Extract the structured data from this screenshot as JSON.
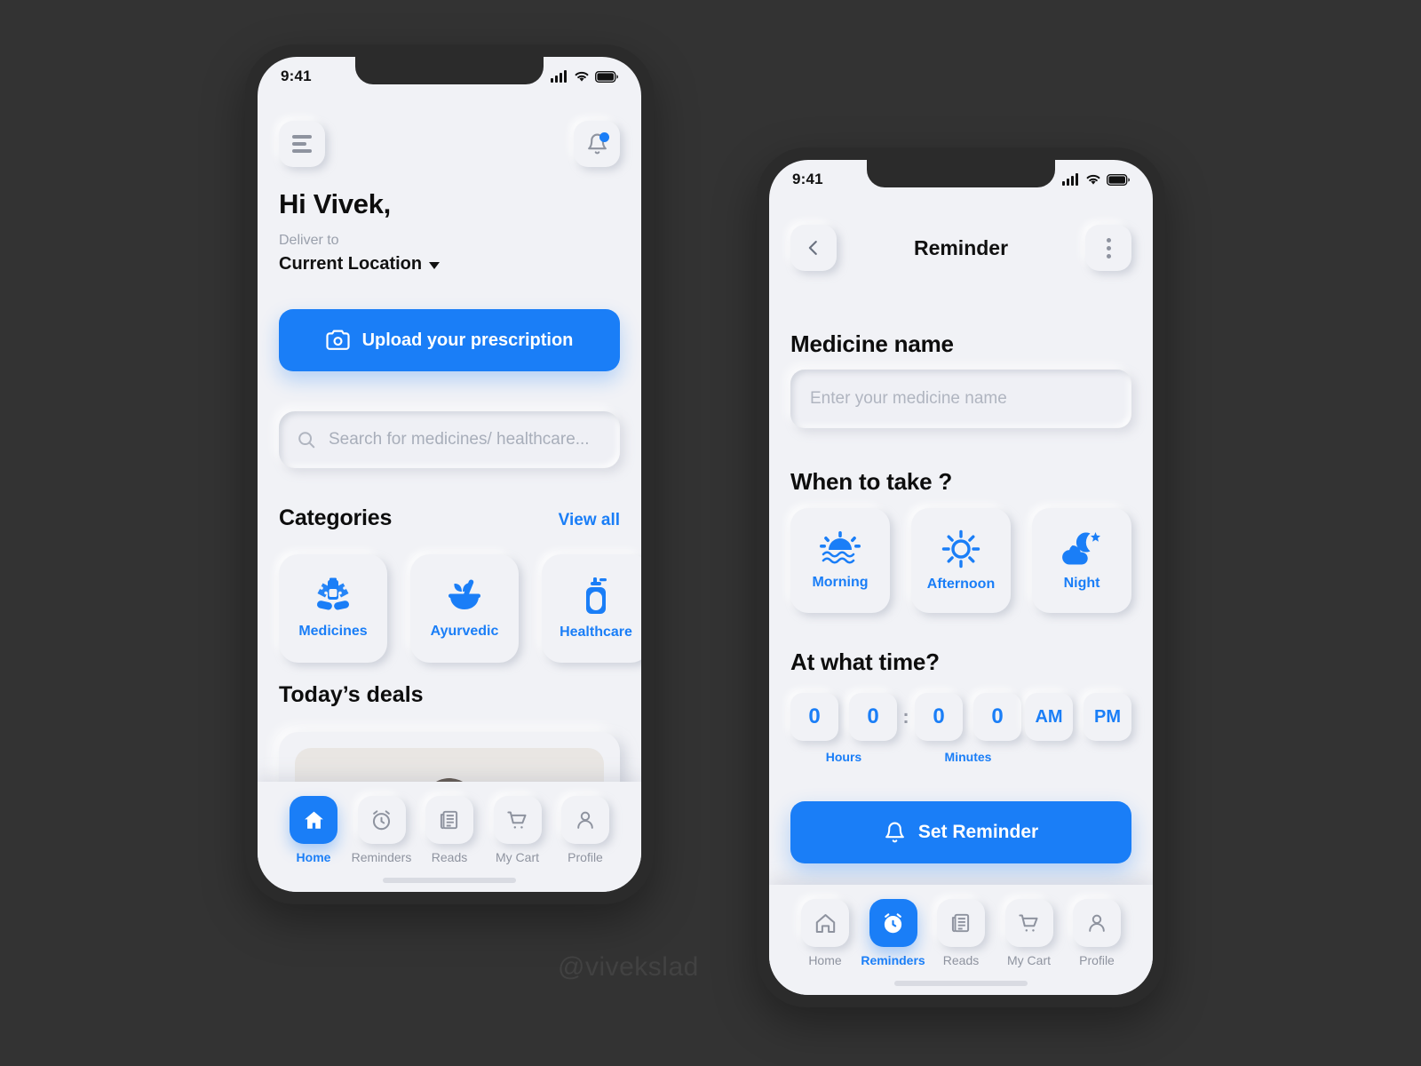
{
  "watermark": "@vivekslad",
  "colors": {
    "accent": "#1a7ef7",
    "screen_bg": "#f1f2f6",
    "page_bg": "#333333",
    "muted": "#8e939f"
  },
  "phone1": {
    "status": {
      "time": "9:41",
      "icons": [
        "signal-icon",
        "wifi-icon",
        "battery-icon"
      ]
    },
    "menu_icon": "hamburger-menu-icon",
    "bell_icon": "notification-bell-icon",
    "greeting": "Hi Vivek,",
    "deliver_label": "Deliver to",
    "deliver_value": "Current Location",
    "upload": {
      "label": "Upload your prescription",
      "icon": "camera-icon"
    },
    "search": {
      "placeholder": "Search for medicines/ healthcare...",
      "icon": "search-icon"
    },
    "categories": {
      "title": "Categories",
      "view_all": "View all",
      "items": [
        {
          "label": "Medicines",
          "icon": "pills-blister-icon"
        },
        {
          "label": "Ayurvedic",
          "icon": "mortar-pestle-icon"
        },
        {
          "label": "Healthcare",
          "icon": "sanitizer-bottle-icon"
        }
      ]
    },
    "deals": {
      "title": "Today’s deals"
    },
    "nav": {
      "items": [
        {
          "label": "Home",
          "icon": "home-icon",
          "active": true
        },
        {
          "label": "Reminders",
          "icon": "alarm-clock-icon",
          "active": false
        },
        {
          "label": "Reads",
          "icon": "newspaper-icon",
          "active": false
        },
        {
          "label": "My Cart",
          "icon": "shopping-cart-icon",
          "active": false
        },
        {
          "label": "Profile",
          "icon": "person-icon",
          "active": false
        }
      ]
    }
  },
  "phone2": {
    "status": {
      "time": "9:41",
      "icons": [
        "signal-icon",
        "wifi-icon",
        "battery-icon"
      ]
    },
    "back_icon": "chevron-left-icon",
    "title": "Reminder",
    "more_icon": "more-vertical-icon",
    "medicine": {
      "label": "Medicine name",
      "placeholder": "Enter your medicine name",
      "value": ""
    },
    "when": {
      "label": "When to take ?",
      "options": [
        {
          "label": "Morning",
          "icon": "sunrise-icon"
        },
        {
          "label": "Afternoon",
          "icon": "sun-icon"
        },
        {
          "label": "Night",
          "icon": "moon-cloud-icon"
        }
      ]
    },
    "time": {
      "label": "At what time?",
      "hour_digits": [
        "0",
        "0"
      ],
      "separator": ":",
      "minute_digits": [
        "0",
        "0"
      ],
      "hours_label": "Hours",
      "minutes_label": "Minutes",
      "meridiem": [
        "AM",
        "PM"
      ]
    },
    "set_button": {
      "label": "Set Reminder",
      "icon": "bell-icon"
    },
    "nav": {
      "items": [
        {
          "label": "Home",
          "icon": "home-icon",
          "active": false
        },
        {
          "label": "Reminders",
          "icon": "alarm-clock-icon",
          "active": true
        },
        {
          "label": "Reads",
          "icon": "newspaper-icon",
          "active": false
        },
        {
          "label": "My Cart",
          "icon": "shopping-cart-icon",
          "active": false
        },
        {
          "label": "Profile",
          "icon": "person-icon",
          "active": false
        }
      ]
    }
  }
}
